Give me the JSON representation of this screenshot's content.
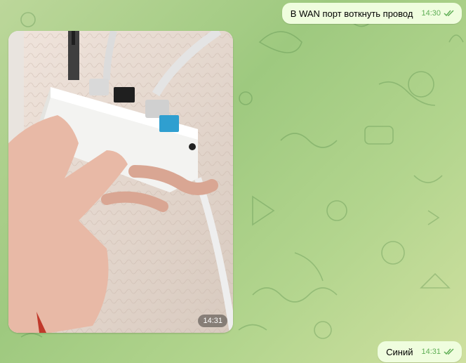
{
  "messages": [
    {
      "text": "В WAN порт воткнуть провод",
      "time": "14:30",
      "status": "read-double-check"
    },
    {
      "type": "photo",
      "time": "14:31",
      "content": "photo-router-in-hand"
    },
    {
      "text": "Синий",
      "time": "14:31",
      "status": "read-double-check"
    }
  ],
  "colors": {
    "outgoing_bubble": "#effdde",
    "check_mark": "#5fae55",
    "background": "#a8cd86"
  }
}
